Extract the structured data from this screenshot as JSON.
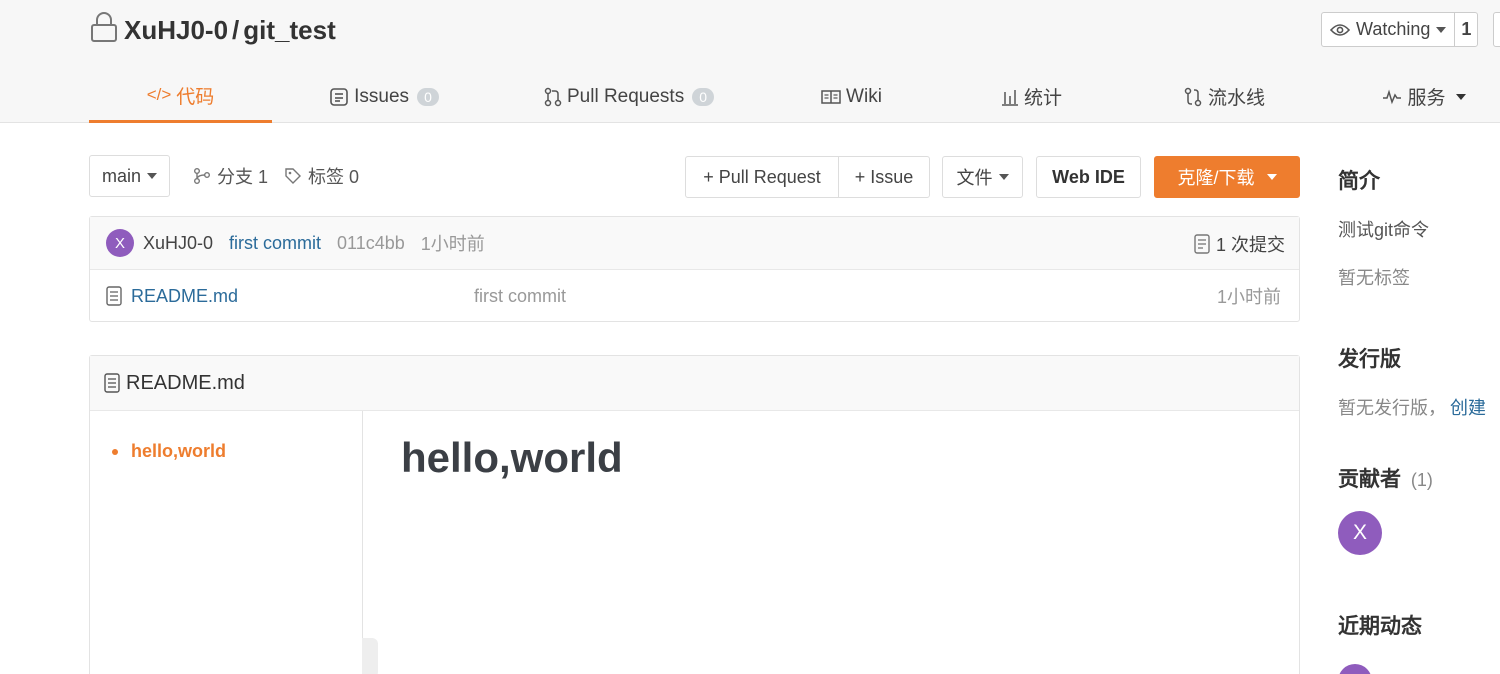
{
  "repo": {
    "owner": "XuHJ0-0",
    "separator": "/",
    "name": "git_test"
  },
  "watch": {
    "label": "Watching",
    "count": "1"
  },
  "tabs": [
    {
      "label": "代码",
      "count": ""
    },
    {
      "label": "Issues",
      "count": "0"
    },
    {
      "label": "Pull Requests",
      "count": "0"
    },
    {
      "label": "Wiki",
      "count": ""
    },
    {
      "label": "统计",
      "count": ""
    },
    {
      "label": "流水线",
      "count": ""
    },
    {
      "label": "服务",
      "count": ""
    }
  ],
  "toolbar": {
    "branch": "main",
    "branches_label": "分支 1",
    "tags_label": "标签 0",
    "pull_request": "+ Pull Request",
    "issue": "+ Issue",
    "file": "文件",
    "web_ide": "Web IDE",
    "clone": "克隆/下载"
  },
  "commit": {
    "avatar_letter": "X",
    "author": "XuHJ0-0",
    "message": "first commit",
    "hash": "011c4bb",
    "time": "1小时前",
    "total": "1 次提交"
  },
  "files": [
    {
      "name": "README.md",
      "message": "first commit",
      "time": "1小时前"
    }
  ],
  "readme": {
    "filename": "README.md",
    "toc": [
      "hello,world"
    ],
    "heading": "hello,world"
  },
  "sidebar": {
    "intro_title": "简介",
    "intro_text": "测试git命令",
    "no_tags": "暂无标签",
    "release_title": "发行版",
    "no_release": "暂无发行版，",
    "create": "创建",
    "contributors_title": "贡献者",
    "contributors_count": "(1)",
    "contributor_letter": "X",
    "activity_title": "近期动态"
  },
  "colors": {
    "accent": "#ee7d2e",
    "avatar": "#8f5cbd",
    "link": "#2b6b9a"
  }
}
